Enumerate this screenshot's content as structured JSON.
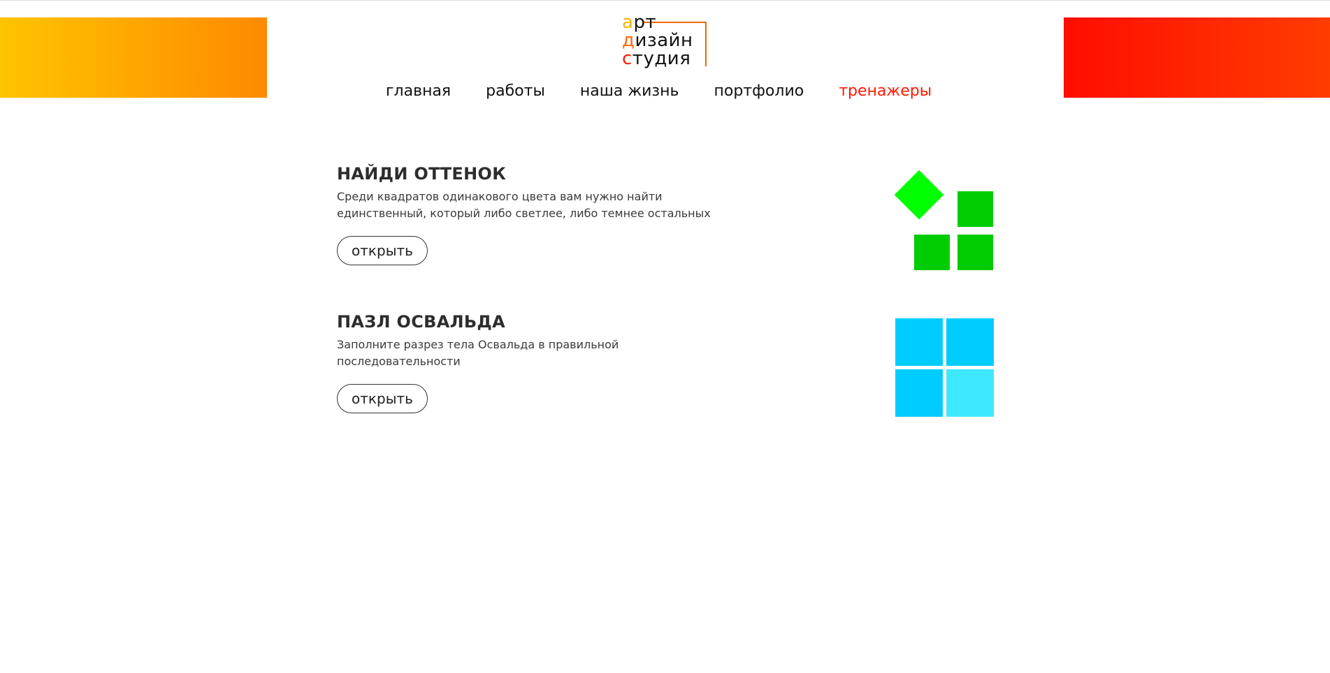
{
  "logo": {
    "line1_first": "а",
    "line1_rest": "рт",
    "line2_first": "д",
    "line2_rest": "изайн",
    "line3_first": "с",
    "line3_rest": "тудия"
  },
  "nav": {
    "items": [
      {
        "label": "главная"
      },
      {
        "label": "работы"
      },
      {
        "label": "наша жизнь"
      },
      {
        "label": "портфолио"
      },
      {
        "label": "тренажеры"
      }
    ]
  },
  "trainers": [
    {
      "title": "НАЙДИ ОТТЕНОК",
      "description": "Среди квадратов одинакового цвета вам нужно найти единственный, который либо светлее, либо темнее остальных",
      "button": "открыть",
      "icon": "green-squares-icon",
      "colors": {
        "light": "#00ff00",
        "dark": "#00cc00"
      }
    },
    {
      "title": "ПАЗЛ ОСВАЛЬДА",
      "description": "Заполните разрез тела Освальда в правильной последовательности",
      "button": "открыть",
      "icon": "blue-squares-icon",
      "colors": {
        "main": "#00ccff",
        "light": "#3ee9ff"
      }
    }
  ],
  "colors": {
    "accent": "#ff1a00",
    "banner_left_start": "#ffc400",
    "banner_left_end": "#ff8a00",
    "banner_right_start": "#ff0d00",
    "banner_right_end": "#ff3d00"
  }
}
